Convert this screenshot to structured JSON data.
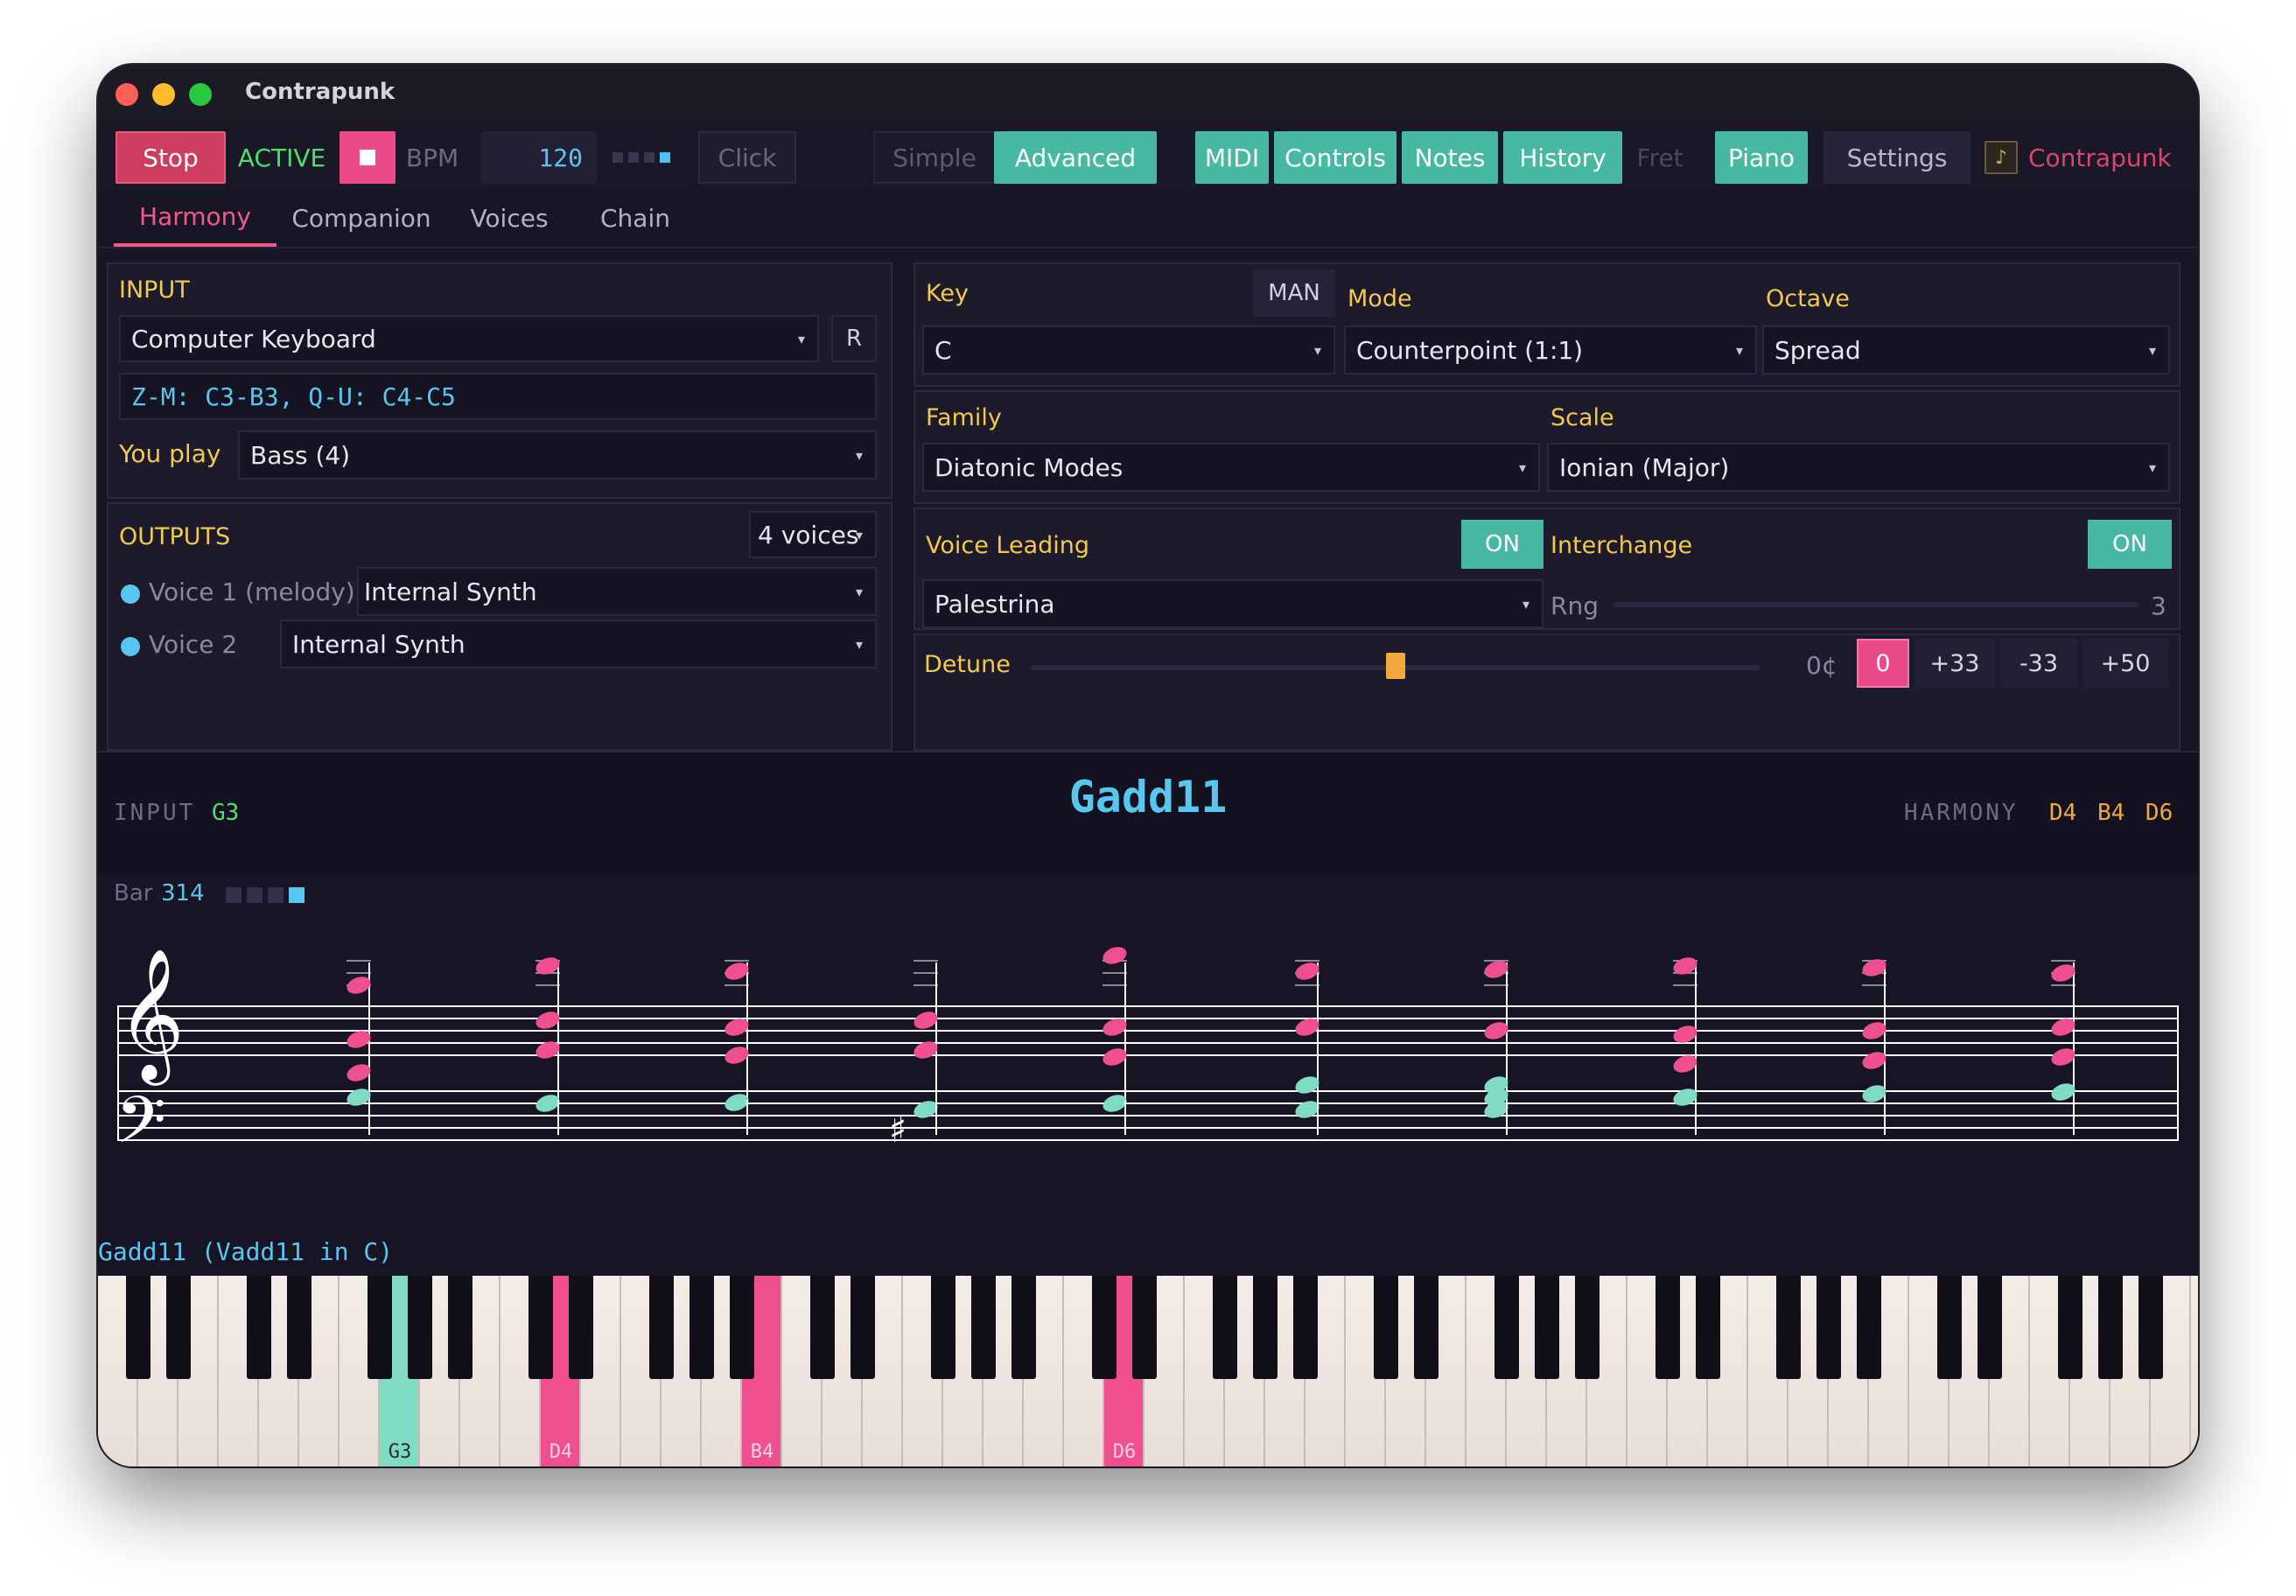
{
  "window": {
    "title": "Contrapunk"
  },
  "toolbar": {
    "stop": "Stop",
    "active": "ACTIVE",
    "bpm_label": "BPM",
    "bpm": "120",
    "click": "Click",
    "simple": "Simple",
    "advanced": "Advanced",
    "midi": "MIDI",
    "controls": "Controls",
    "notes": "Notes",
    "history": "History",
    "fret": "Fret",
    "piano": "Piano",
    "settings": "Settings",
    "brand": "Contrapunk"
  },
  "tabs": [
    "Harmony",
    "Companion",
    "Voices",
    "Chain"
  ],
  "input": {
    "title": "INPUT",
    "device": "Computer Keyboard",
    "refresh": "R",
    "mapping": "Z-M: C3-B3, Q-U: C4-C5",
    "you_play_label": "You play",
    "you_play": "Bass (4)"
  },
  "outputs": {
    "title": "OUTPUTS",
    "voices_count": "4 voices",
    "voices": [
      {
        "label": "Voice 1 (melody)",
        "synth": "Internal Synth"
      },
      {
        "label": "Voice 2",
        "synth": "Internal Synth"
      }
    ]
  },
  "harmony": {
    "key_label": "Key",
    "man": "MAN",
    "key": "C",
    "mode_label": "Mode",
    "mode": "Counterpoint (1:1)",
    "octave_label": "Octave",
    "octave": "Spread",
    "family_label": "Family",
    "family": "Diatonic Modes",
    "scale_label": "Scale",
    "scale": "Ionian (Major)",
    "voice_leading_label": "Voice Leading",
    "voice_leading_toggle": "ON",
    "voice_leading": "Palestrina",
    "interchange_label": "Interchange",
    "interchange_toggle": "ON",
    "range_label": "Rng",
    "range_value": "3",
    "range_fraction": 0.49,
    "detune_label": "Detune",
    "detune_value": "0¢",
    "detune_fraction": 0.5,
    "detune_presets": [
      "0",
      "+33",
      "-33",
      "+50"
    ]
  },
  "chord_display": {
    "input_label": "INPUT",
    "input_note": "G3",
    "chord": "Gadd11",
    "harmony_label": "HARMONY",
    "harmony_notes": "D4 B4 D6"
  },
  "staff": {
    "bar_label": "Bar",
    "bar": "314",
    "beat": 4,
    "beats_total": 4
  },
  "piano": {
    "chord_text": "Gadd11 (Vadd11 in C)",
    "highlights": [
      {
        "note": "G3",
        "role": "input"
      },
      {
        "note": "D4",
        "role": "harmony"
      },
      {
        "note": "B4",
        "role": "harmony"
      },
      {
        "note": "D6",
        "role": "harmony"
      }
    ]
  },
  "colors": {
    "accent_teal": "#47b8a2",
    "accent_pink": "#ef4f8f",
    "label_yellow": "#f1c94b",
    "info_blue": "#58c7f0",
    "active_green": "#4ee06b",
    "harmony_orange": "#f2a83b"
  }
}
